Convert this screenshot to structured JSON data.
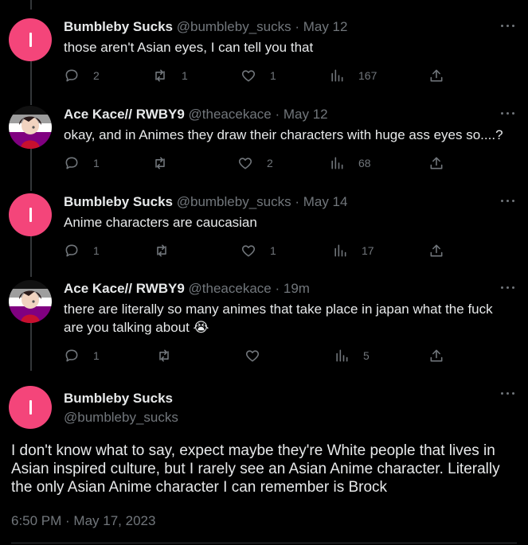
{
  "tweets": [
    {
      "name": "Bumbleby Sucks",
      "handle": "@bumbleby_sucks · May 12",
      "text": "those aren't Asian eyes, I can tell you that",
      "replies": "2",
      "retweets": "1",
      "likes": "1",
      "views": "167"
    },
    {
      "name": "Ace Kace// RWBY9",
      "handle": "@theacekace · May 12",
      "text": "okay, and in Animes they draw their characters with huge ass eyes so....?",
      "replies": "1",
      "retweets": "",
      "likes": "2",
      "views": "68"
    },
    {
      "name": "Bumbleby Sucks",
      "handle": "@bumbleby_sucks · May 14",
      "text": "Anime characters are caucasian",
      "replies": "1",
      "retweets": "",
      "likes": "1",
      "views": "17"
    },
    {
      "name": "Ace Kace// RWBY9",
      "handle": "@theacekace · 19m",
      "text": "there are literally so many animes that take place in japan what the fuck are you talking about 😭",
      "replies": "1",
      "retweets": "",
      "likes": "",
      "views": "5"
    }
  ],
  "main": {
    "name": "Bumbleby Sucks",
    "handle": "@bumbleby_sucks",
    "text": "I don't know what to say, expect maybe they're White people that lives in Asian inspired culture, but I rarely see an Asian Anime character. Literally the only Asian Anime character I can remember is Brock",
    "timestamp": "6:50 PM · May 17, 2023"
  },
  "icons": [
    "reply-icon",
    "retweet-icon",
    "like-icon",
    "views-icon",
    "share-icon",
    "more-icon"
  ],
  "colors": {
    "background": "#000000",
    "text": "#e7e9ea",
    "secondary": "#71767b",
    "avatar_pink": "#f4457a"
  }
}
